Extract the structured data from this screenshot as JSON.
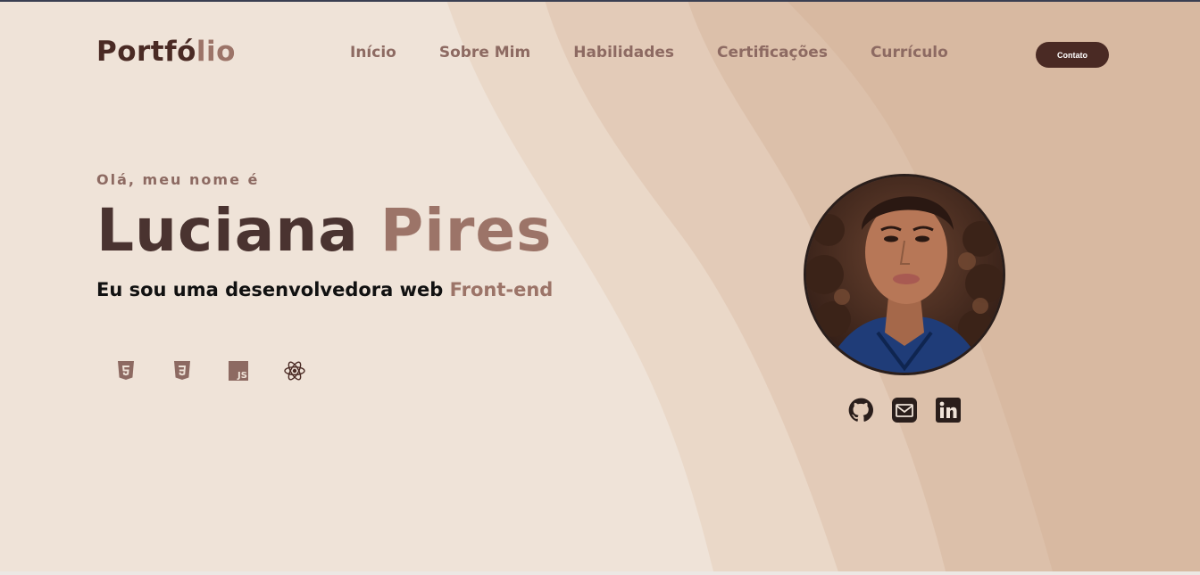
{
  "header": {
    "logo_main": "Portfó",
    "logo_accent": "lio",
    "nav": [
      "Início",
      "Sobre Mim",
      "Habilidades",
      "Certificações",
      "Currículo"
    ],
    "contact_button": "Contato"
  },
  "hero": {
    "greeting": "Olá, meu nome é",
    "first_name": "Luciana",
    "last_name": "Pires",
    "role_prefix": "Eu sou uma desenvolvedora web",
    "role_accent": "Front-end"
  },
  "tech_icons": [
    "html5-icon",
    "css3-icon",
    "javascript-icon",
    "react-icon"
  ],
  "social_icons": [
    "github-icon",
    "email-icon",
    "linkedin-icon"
  ],
  "colors": {
    "primary_dark": "#4a2a24",
    "accent": "#9c7468",
    "background": "#efe2d6"
  }
}
